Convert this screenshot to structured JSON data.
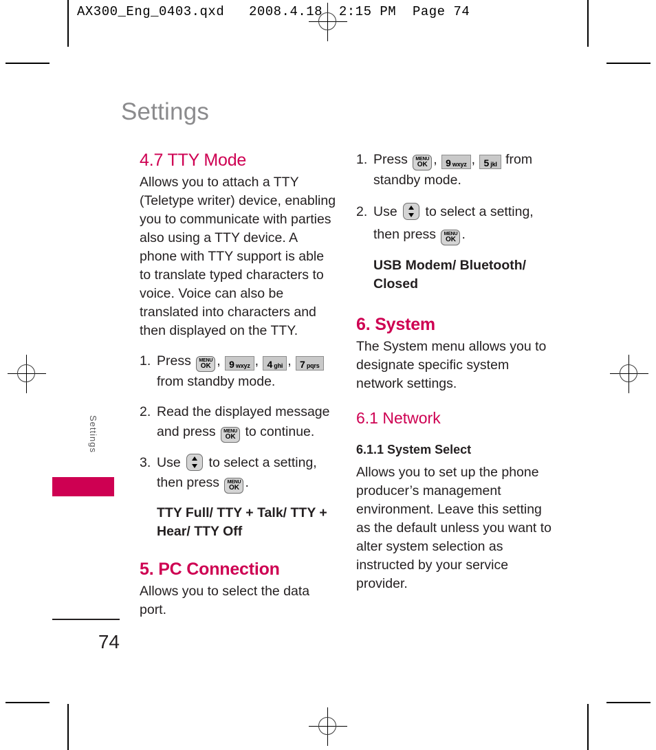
{
  "slug": {
    "text": "AX300_Eng_0403.qxd   2008.4.18  2:15 PM  Page 74"
  },
  "colors": {
    "heading": "#ce0052",
    "title": "#8b8b8d",
    "body": "#231f20",
    "tab": "#ce0052",
    "key_face": "#c9c9c9"
  },
  "margin": {
    "side_label": "Settings",
    "folio": "74"
  },
  "page_title": "Settings",
  "keys": {
    "menu_ok": {
      "line1": "MENU",
      "line2": "OK",
      "name": "menu-ok-key"
    },
    "nav_updown": {
      "name": "up-down-navigation-key"
    },
    "k9": {
      "digit": "9",
      "letters": "wxyz"
    },
    "k4": {
      "digit": "4",
      "letters": "ghi"
    },
    "k7": {
      "digit": "7",
      "letters": "pqrs"
    },
    "k5": {
      "digit": "5",
      "letters": "jkl"
    }
  },
  "left_column": {
    "tty": {
      "heading": "4.7 TTY Mode",
      "body": "Allows you to attach a TTY (Teletype writer) device, enabling you to communicate with parties also using a TTY device. A phone with TTY support is able to translate typed characters to voice. Voice can also be translated into characters and then displayed on the TTY.",
      "steps": [
        {
          "num": "1.",
          "pre": "Press",
          "mid": ",",
          "mid2": ",",
          "mid3": ",",
          "post": "from standby mode."
        },
        {
          "num": "2.",
          "pre": "Read the displayed message and press",
          "post": "to continue."
        },
        {
          "num": "3.",
          "pre": "Use",
          "mid": "to select a setting, then press",
          "post": "."
        }
      ],
      "options": "TTY Full/ TTY + Talk/ TTY + Hear/ TTY Off"
    },
    "pc_connection": {
      "heading": "5. PC Connection",
      "body": "Allows you to select the data port."
    }
  },
  "right_column": {
    "pc_steps": [
      {
        "num": "1.",
        "pre": "Press",
        "mid": ",",
        "mid2": ",",
        "post": "from standby mode."
      },
      {
        "num": "2.",
        "pre": "Use",
        "mid": "to select a setting, then press",
        "post": "."
      }
    ],
    "pc_options": "USB Modem/ Bluetooth/ Closed",
    "system": {
      "heading": "6. System",
      "body": "The System menu allows you to designate specific system network settings."
    },
    "network": {
      "heading": "6.1 Network",
      "subheading": "6.1.1 System Select",
      "body": "Allows you to set up the phone producer’s management environment. Leave this setting as the default unless you want to alter system selection as instructed by your service provider."
    }
  }
}
